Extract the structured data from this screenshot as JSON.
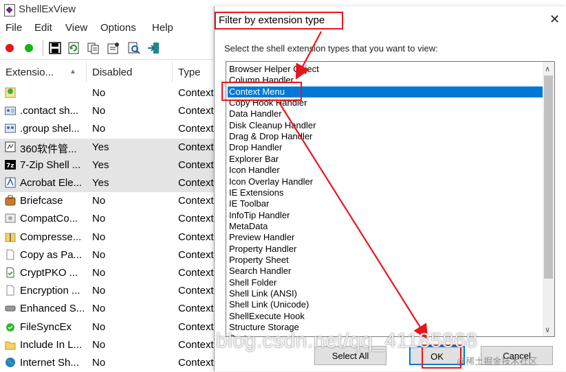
{
  "app": {
    "title": "ShellExView"
  },
  "menu": [
    "File",
    "Edit",
    "View",
    "Options",
    "Help"
  ],
  "toolbar": [
    "red-dot-icon",
    "green-dot-icon",
    "save-icon",
    "refresh-icon",
    "copy-icon",
    "properties-icon",
    "find-icon",
    "exit-icon"
  ],
  "list": {
    "columns": [
      "Extensio...",
      "Disabled",
      "Type"
    ],
    "rows": [
      {
        "icon": "green-puzzle-icon",
        "name": "",
        "disabled": "No",
        "type": "Context",
        "highlight": false
      },
      {
        "icon": "contact-card-icon",
        "name": ".contact sh...",
        "disabled": "No",
        "type": "Context",
        "highlight": false
      },
      {
        "icon": "group-icon",
        "name": ".group shel...",
        "disabled": "No",
        "type": "Context",
        "highlight": false
      },
      {
        "icon": "360-icon",
        "name": "360软件管...",
        "disabled": "Yes",
        "type": "Context",
        "highlight": true
      },
      {
        "icon": "7zip-icon",
        "name": "7-Zip Shell ...",
        "disabled": "Yes",
        "type": "Context",
        "highlight": true
      },
      {
        "icon": "acrobat-icon",
        "name": "Acrobat Ele...",
        "disabled": "Yes",
        "type": "Context",
        "highlight": true
      },
      {
        "icon": "briefcase-icon",
        "name": "Briefcase",
        "disabled": "No",
        "type": "Context",
        "highlight": false
      },
      {
        "icon": "compat-icon",
        "name": "CompatCo...",
        "disabled": "No",
        "type": "Context",
        "highlight": false
      },
      {
        "icon": "zip-folder-icon",
        "name": "Compresse...",
        "disabled": "No",
        "type": "Context",
        "highlight": false
      },
      {
        "icon": "document-icon",
        "name": "Copy as Pa...",
        "disabled": "No",
        "type": "Context",
        "highlight": false
      },
      {
        "icon": "cryptpko-icon",
        "name": "CryptPKO ...",
        "disabled": "No",
        "type": "Context",
        "highlight": false
      },
      {
        "icon": "document-icon",
        "name": "Encryption ...",
        "disabled": "No",
        "type": "Context",
        "highlight": false
      },
      {
        "icon": "drive-icon",
        "name": "Enhanced S...",
        "disabled": "No",
        "type": "Context",
        "highlight": false
      },
      {
        "icon": "green-check-icon",
        "name": "FileSyncEx",
        "disabled": "No",
        "type": "Context",
        "highlight": false
      },
      {
        "icon": "folder-icon",
        "name": "Include In L...",
        "disabled": "No",
        "type": "Context",
        "highlight": false
      },
      {
        "icon": "globe-icon",
        "name": "Internet Sh...",
        "disabled": "No",
        "type": "Context",
        "highlight": false
      }
    ]
  },
  "dialog": {
    "title": "Filter by extension type",
    "prompt": "Select the shell extension types that you want to view:",
    "options": [
      "Browser Helper Object",
      "Column Handler",
      "Context Menu",
      "Copy Hook Handler",
      "Data Handler",
      "Disk Cleanup Handler",
      "Drag & Drop Handler",
      "Drop Handler",
      "Explorer Bar",
      "Icon Handler",
      "Icon Overlay Handler",
      "IE Extensions",
      "IE Toolbar",
      "InfoTip Handler",
      "MetaData",
      "Preview Handler",
      "Property Handler",
      "Property Sheet",
      "Search Handler",
      "Shell Folder",
      "Shell Link (ANSI)",
      "Shell Link (Unicode)",
      "ShellExecute Hook",
      "Structure Storage",
      "System"
    ],
    "selected_index": 2,
    "buttons": {
      "select_all": "Select All",
      "ok": "OK",
      "cancel": "Cancel"
    }
  },
  "watermark": "blog.csdn.net/qq_41185868",
  "watermark2": "@稀土掘金技术社区",
  "colors": {
    "selection": "#0078d7",
    "annotation": "#e8141c"
  }
}
